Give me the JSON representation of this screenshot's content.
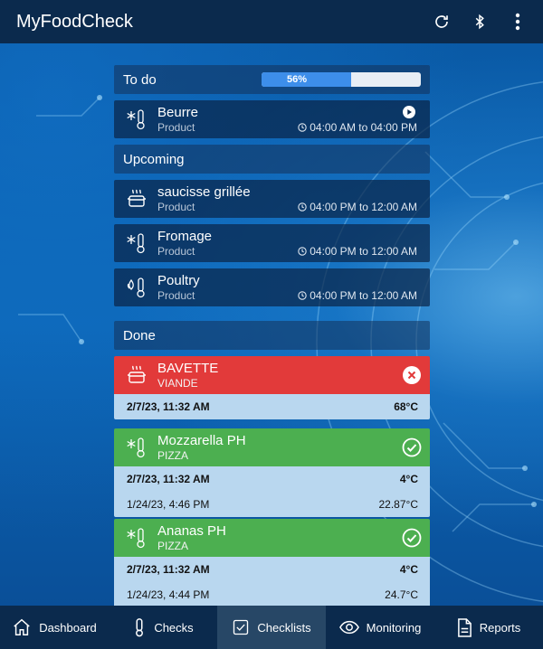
{
  "app": {
    "title": "MyFoodCheck"
  },
  "todo": {
    "header": "To do",
    "progress_percent": 56,
    "progress_label": "56%",
    "items": [
      {
        "name": "Beurre",
        "type": "Product",
        "time": "04:00 AM to 04:00 PM",
        "icon": "fridge-thermometer-icon"
      }
    ]
  },
  "upcoming": {
    "header": "Upcoming",
    "items": [
      {
        "name": "saucisse grillée",
        "type": "Product",
        "time": "04:00 PM to 12:00 AM",
        "icon": "cooking-pot-icon"
      },
      {
        "name": "Fromage",
        "type": "Product",
        "time": "04:00 PM to 12:00 AM",
        "icon": "fridge-thermometer-icon"
      },
      {
        "name": "Poultry",
        "type": "Product",
        "time": "04:00 PM to 12:00 AM",
        "icon": "hot-thermometer-icon"
      }
    ]
  },
  "done": {
    "header": "Done",
    "items": [
      {
        "name": "BAVETTE",
        "type": "VIANDE",
        "status": "fail",
        "icon": "cooking-pot-icon",
        "readings": [
          {
            "date": "2/7/23, 11:32 AM",
            "value": "68°C"
          }
        ]
      },
      {
        "name": "Mozzarella PH",
        "type": "PIZZA",
        "status": "pass",
        "icon": "fridge-thermometer-icon",
        "readings": [
          {
            "date": "2/7/23, 11:32 AM",
            "value": "4°C"
          },
          {
            "date": "1/24/23, 4:46 PM",
            "value": "22.87°C"
          }
        ]
      },
      {
        "name": "Ananas PH",
        "type": "PIZZA",
        "status": "pass",
        "icon": "fridge-thermometer-icon",
        "readings": [
          {
            "date": "2/7/23, 11:32 AM",
            "value": "4°C"
          },
          {
            "date": "1/24/23, 4:44 PM",
            "value": "24.7°C"
          }
        ]
      }
    ]
  },
  "nav": [
    {
      "label": "Dashboard",
      "icon": "home-icon"
    },
    {
      "label": "Checks",
      "icon": "thermometer-icon"
    },
    {
      "label": "Checklists",
      "icon": "checkbox-icon",
      "active": true
    },
    {
      "label": "Monitoring",
      "icon": "eye-icon"
    },
    {
      "label": "Reports",
      "icon": "document-icon"
    }
  ],
  "colors": {
    "appbar": "#0b2a4d",
    "fail": "#e23a3a",
    "pass": "#4caf50",
    "reading_bg": "#b9d7ef",
    "progress": "#3d8eea"
  }
}
